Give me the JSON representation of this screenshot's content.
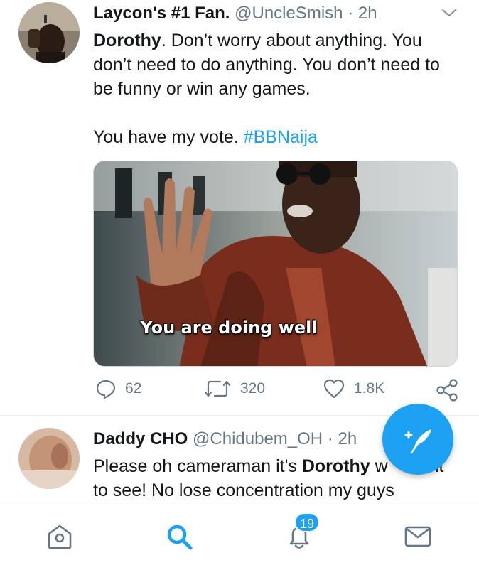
{
  "tweets": [
    {
      "display_name": "Laycon's #1 Fan.",
      "handle": "@UncleSmish",
      "separator": "·",
      "time": "2h",
      "body": {
        "line_bold": "Dorothy",
        "line_rest": ". Don’t worry about anything. You don’t need to do anything. You don’t need to be funny or win any games.",
        "line2": "You have my vote. ",
        "hashtag": "#BBNaija"
      },
      "media": {
        "caption": "You are doing well"
      },
      "actions": {
        "replies": "62",
        "retweets": "320",
        "likes": "1.8K"
      }
    },
    {
      "display_name": "Daddy CHO",
      "handle": "@Chidubem_OH",
      "separator": "·",
      "time": "2h",
      "body": {
        "part1": "Please oh cameraman it's ",
        "bold": "Dorothy",
        "part2": " w",
        "part3": "nt",
        "line2": "to see! No lose concentration my guys"
      }
    }
  ],
  "navbar": {
    "items": [
      "home-icon",
      "search-icon",
      "notifications-icon",
      "messages-icon"
    ],
    "notification_badge": "19"
  },
  "colors": {
    "accent": "#1da1f2",
    "text": "#14171a",
    "muted": "#657786"
  }
}
